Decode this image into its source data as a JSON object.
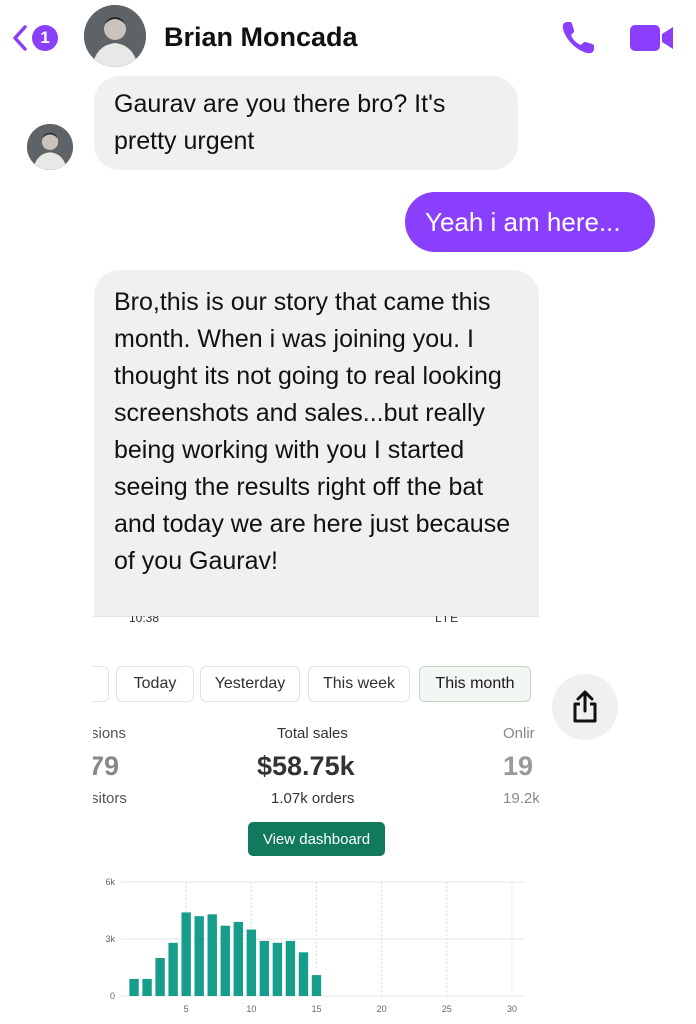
{
  "header": {
    "back_badge": "1",
    "contact_name": "Brian Moncada"
  },
  "messages": [
    {
      "direction": "incoming",
      "text": "Gaurav are you there bro? It's pretty urgent"
    },
    {
      "direction": "outgoing",
      "text": "Yeah i am here..."
    },
    {
      "direction": "incoming",
      "text": "Bro,this is our story that came this month. When i was joining you. I thought its not going to real looking screenshots and sales...but really being working with you I started seeing the results right off the bat and today we are here just because of you Gaurav!"
    }
  ],
  "attachment": {
    "status_time": "10:38",
    "status_network": "LTE",
    "tabs": [
      "Today",
      "Yesterday",
      "This week",
      "This month"
    ],
    "selected_tab": "This month",
    "left_metric": {
      "label": "sions",
      "value": "79",
      "sub": "sitors"
    },
    "center_metric": {
      "label": "Total sales",
      "value": "$58.75k",
      "sub": "1.07k orders"
    },
    "right_metric": {
      "label": "Onlir",
      "value": "19",
      "sub": "19.2k"
    },
    "button_label": "View dashboard"
  },
  "chart_data": {
    "type": "bar",
    "x": [
      1,
      2,
      3,
      4,
      5,
      6,
      7,
      8,
      9,
      10,
      11,
      12,
      13,
      14,
      15
    ],
    "values": [
      0.9,
      0.9,
      2.0,
      2.8,
      4.4,
      4.2,
      4.3,
      3.7,
      3.9,
      3.5,
      2.9,
      2.8,
      2.9,
      2.3,
      1.1
    ],
    "y_ticks": [
      "0",
      "3k",
      "6k"
    ],
    "x_ticks": [
      "5",
      "10",
      "15",
      "20",
      "25",
      "30"
    ],
    "ylim": [
      0,
      6
    ],
    "xlim": [
      0,
      31
    ],
    "bar_color": "#169d8c",
    "grid": true
  },
  "colors": {
    "accent": "#8a3ffc",
    "incoming_bubble": "#f0f0f0",
    "dashboard_button": "#127a5c"
  }
}
